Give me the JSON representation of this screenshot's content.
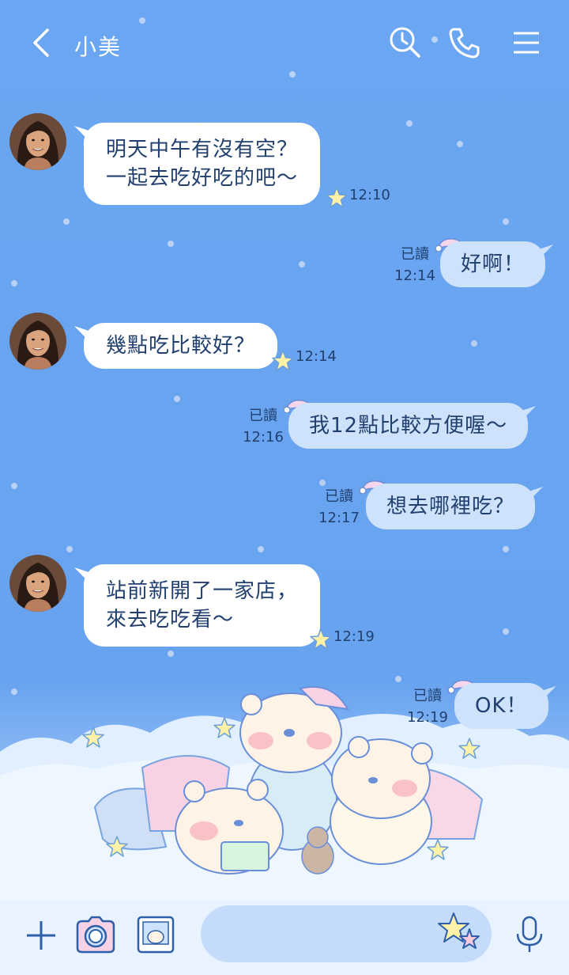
{
  "header": {
    "title": "小美",
    "icons": [
      "back-icon",
      "search-icon",
      "phone-icon",
      "menu-icon"
    ]
  },
  "messages": [
    {
      "side": "in",
      "lines": [
        "明天中午有沒有空？",
        "一起去吃好吃的吧～"
      ],
      "time": "12:10"
    },
    {
      "side": "out",
      "text": "好啊！",
      "read": "已讀",
      "time": "12:14"
    },
    {
      "side": "in",
      "lines": [
        "幾點吃比較好？"
      ],
      "time": "12:14"
    },
    {
      "side": "out",
      "text": "我12點比較方便喔～",
      "read": "已讀",
      "time": "12:16"
    },
    {
      "side": "out",
      "text": "想去哪裡吃？",
      "read": "已讀",
      "time": "12:17"
    },
    {
      "side": "in",
      "lines": [
        "站前新開了一家店，",
        "來去吃吃看～"
      ],
      "time": "12:19"
    },
    {
      "side": "out",
      "text": "OK！",
      "read": "已讀",
      "time": "12:19"
    }
  ],
  "input_bar": {
    "icons": [
      "plus-icon",
      "camera-icon",
      "image-icon",
      "sticker-icon",
      "mic-icon"
    ],
    "placeholder": ""
  },
  "colors": {
    "background": "#68a3ef",
    "bubble_in": "#ffffff",
    "bubble_out": "#cfe2fb",
    "text": "#21406f",
    "bar": "#e9f3ff"
  }
}
